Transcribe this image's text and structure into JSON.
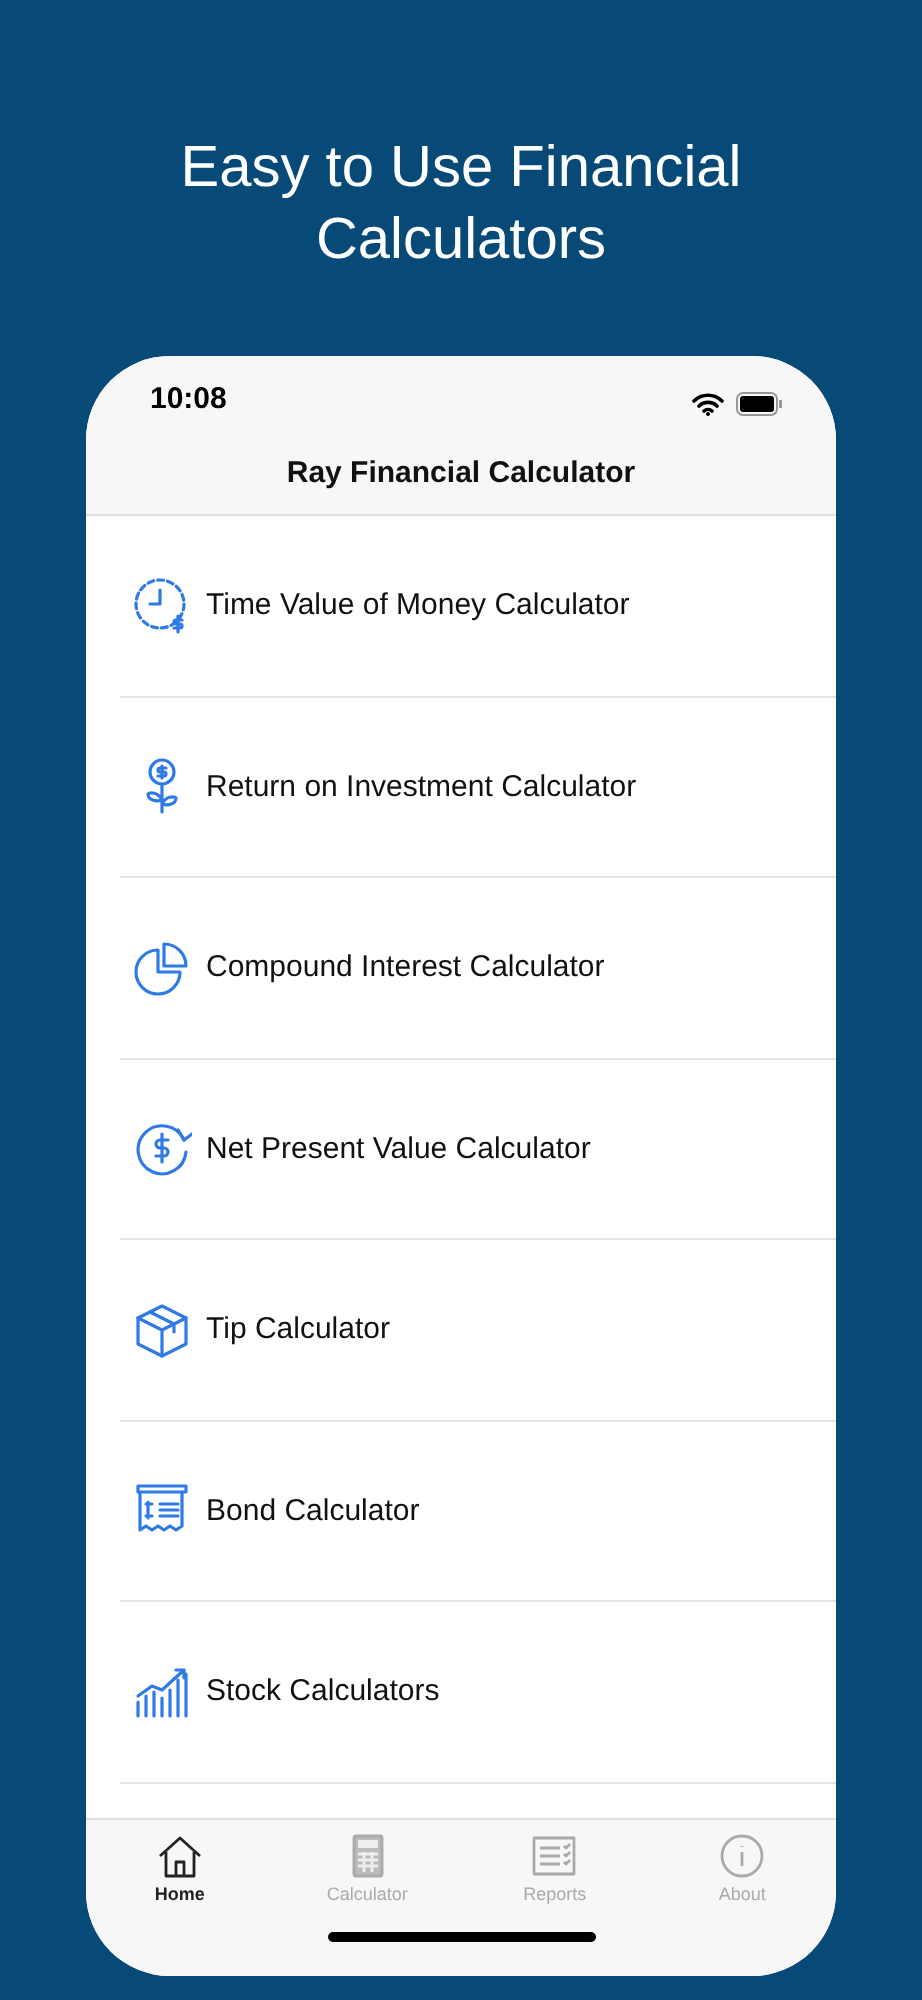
{
  "headline": "Easy to Use Financial Calculators",
  "status_bar": {
    "time": "10:08"
  },
  "nav_title": "Ray Financial Calculator",
  "calculators": [
    {
      "label": "Time Value of Money Calculator"
    },
    {
      "label": "Return on Investment Calculator"
    },
    {
      "label": "Compound Interest Calculator"
    },
    {
      "label": "Net Present Value Calculator"
    },
    {
      "label": "Tip Calculator"
    },
    {
      "label": "Bond Calculator"
    },
    {
      "label": "Stock Calculators"
    }
  ],
  "tabs": [
    {
      "label": "Home",
      "selected": true
    },
    {
      "label": "Calculator",
      "selected": false
    },
    {
      "label": "Reports",
      "selected": false
    },
    {
      "label": "About",
      "selected": false
    }
  ]
}
